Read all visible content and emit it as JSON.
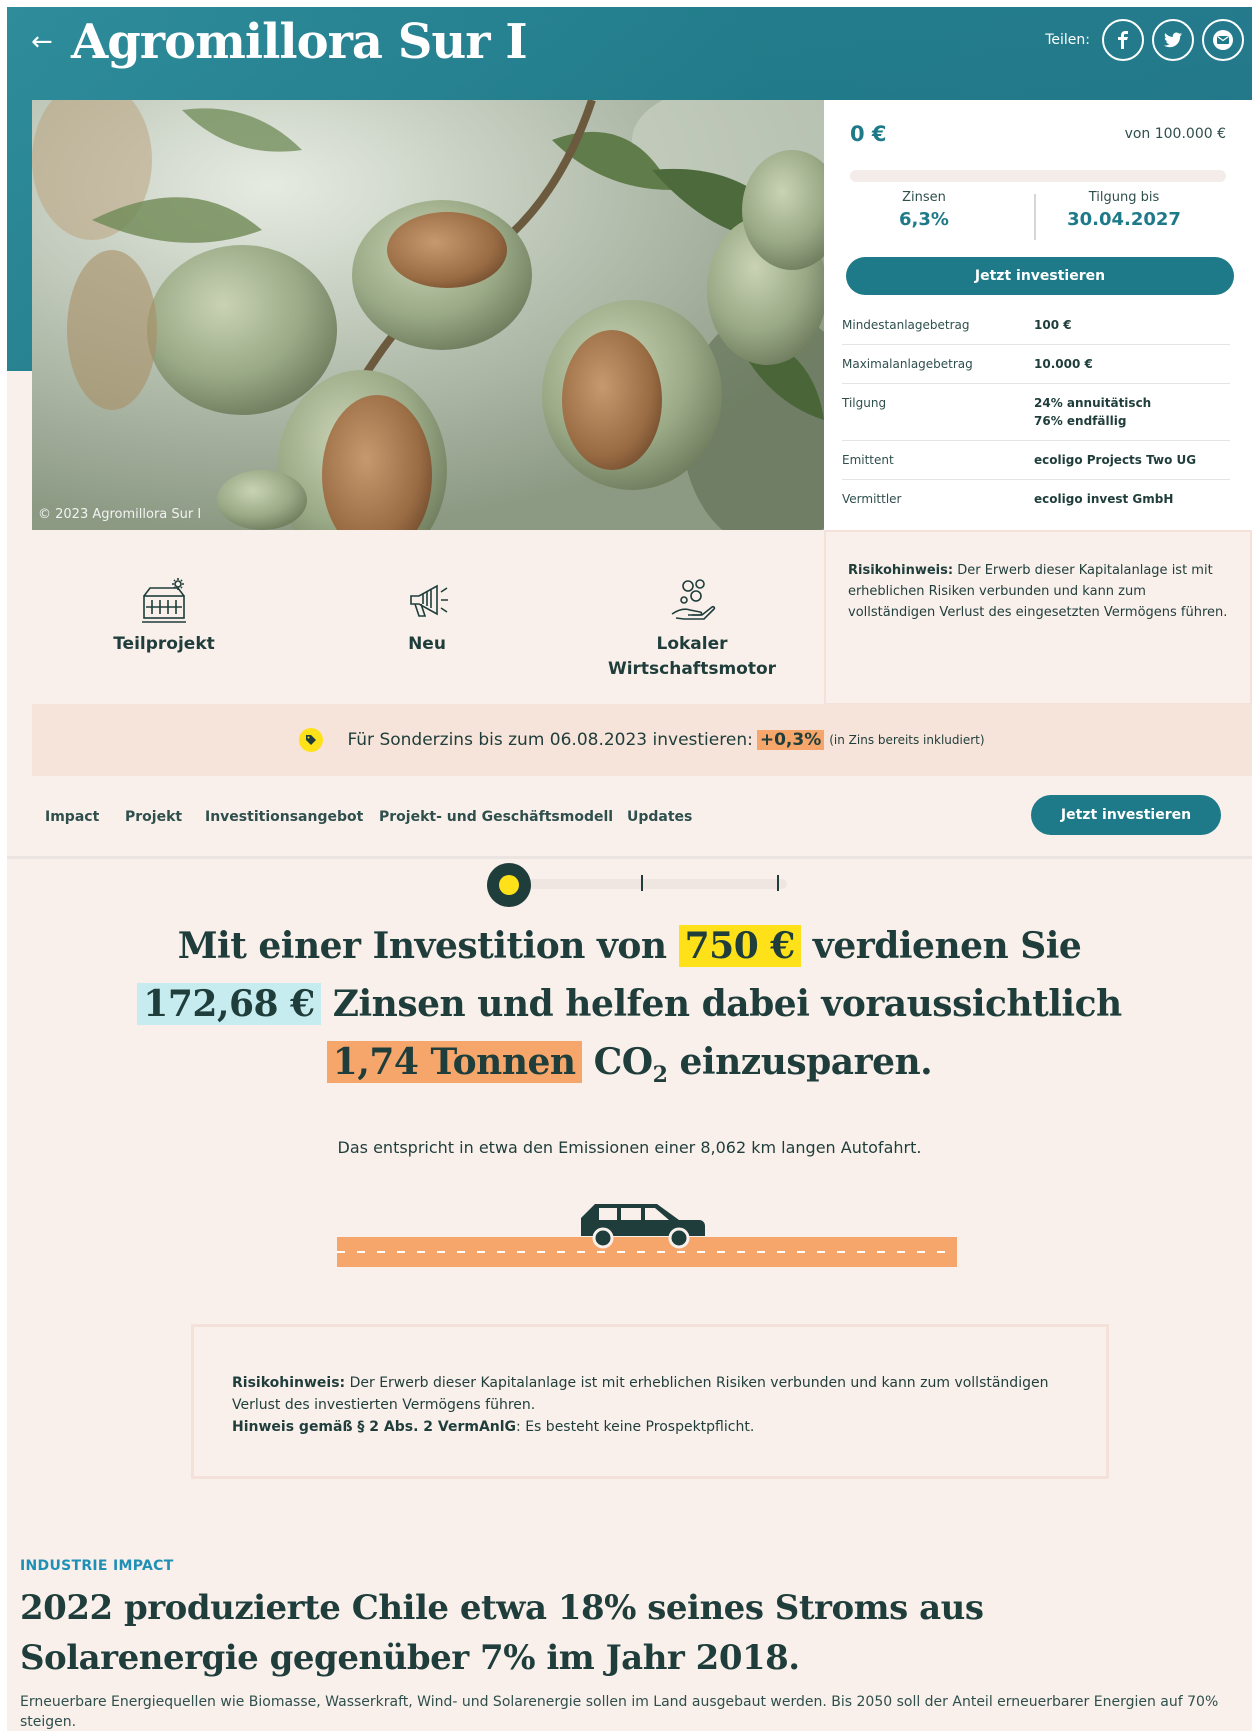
{
  "header": {
    "back_label": "←",
    "title": "Agromillora Sur I",
    "share_label": "Teilen:",
    "share_icons": [
      "facebook-icon",
      "twitter-icon",
      "mail-icon"
    ]
  },
  "hero": {
    "copyright": "© 2023 Agromillora Sur I"
  },
  "invest": {
    "amount": "0 €",
    "goal": "von 100.000 €",
    "progress_fraction": 0.0,
    "interest_label": "Zinsen",
    "interest_value": "6,3%",
    "repayment_label": "Tilgung bis",
    "repayment_value": "30.04.2027",
    "cta": "Jetzt investieren",
    "rows": [
      {
        "key": "Mindestanlagebetrag",
        "value": "100 €"
      },
      {
        "key": "Maximalanlagebetrag",
        "value": "10.000 €"
      },
      {
        "key": "Tilgung",
        "value": "24% annuitätisch\n76% endfällig"
      },
      {
        "key": "Emittent",
        "value": "ecoligo Projects Two UG"
      },
      {
        "key": "Vermittler",
        "value": "ecoligo invest GmbH"
      }
    ]
  },
  "features": [
    {
      "label": "Teilprojekt",
      "icon": "solar-building-icon"
    },
    {
      "label": "Neu",
      "icon": "megaphone-icon"
    },
    {
      "label": "Lokaler Wirtschaftsmotor",
      "icon": "coins-hand-icon"
    }
  ],
  "risk_card": {
    "label": "Risikohinweis:",
    "text": " Der Erwerb dieser Kapitalanlage ist mit erheblichen Risiken verbunden und kann zum vollständigen Verlust des eingesetzten Vermögens führen."
  },
  "promo": {
    "text": "Für Sonderzins bis zum 06.08.2023 investieren:",
    "bonus": "+0,3%",
    "note": "(in Zins bereits inkludiert)"
  },
  "subnav": {
    "items": [
      "Impact",
      "Projekt",
      "Investitionsangebot",
      "Projekt- und Geschäftsmodell",
      "Updates"
    ],
    "cta": "Jetzt investieren"
  },
  "statement": {
    "part1": "Mit einer Investition von",
    "amount": "750 €",
    "part2": "verdienen Sie",
    "interest": "172,68 €",
    "part3": "Zinsen und helfen dabei voraussichtlich",
    "co2": "1,74 Tonnen",
    "part4": "CO",
    "co2_sub": "2",
    "part5": "einzusparen.",
    "equivalent": "Das entspricht in etwa den Emissionen einer 8,062 km langen Autofahrt."
  },
  "disclaimer": {
    "risk_label": "Risikohinweis:",
    "risk_text": " Der Erwerb dieser Kapitalanlage ist mit erheblichen Risiken verbunden und kann zum vollständigen Verlust des investierten Vermögens führen.",
    "notice_label": "Hinweis gemäß § 2 Abs. 2 VermAnlG",
    "notice_text": ": Es besteht keine Prospektpflicht."
  },
  "impact": {
    "kicker": "INDUSTRIE IMPACT",
    "title": "2022 produzierte Chile etwa 18% seines Stroms aus Solarenergie gegenüber 7% im Jahr 2018.",
    "text": "Erneuerbare Energiequellen wie Biomasse, Wasserkraft, Wind- und Solarenergie sollen im Land ausgebaut werden. Bis 2050 soll der Anteil erneuerbarer Energien auf 70% steigen."
  },
  "colors": {
    "teal": "#1e7a89",
    "dark": "#1f3d3a",
    "yellow": "#ffe11a",
    "cyan": "#c6ecf0",
    "orange": "#f6a66b",
    "background": "#f9f0ec"
  }
}
